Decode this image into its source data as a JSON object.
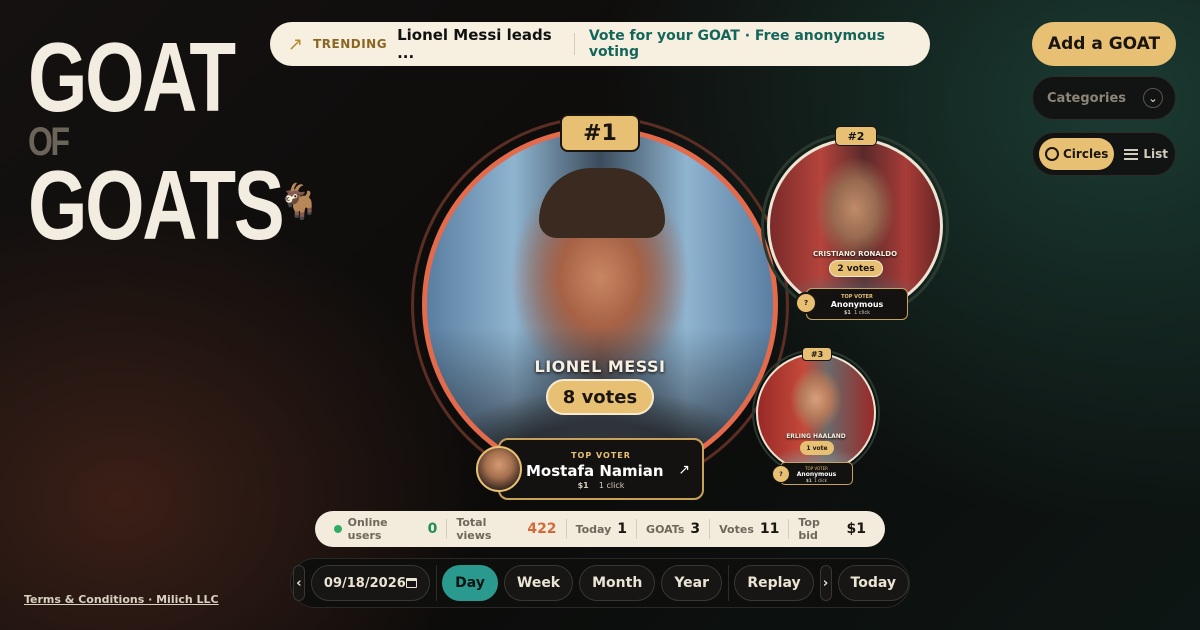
{
  "logo": {
    "line1": "GOAT",
    "line2": "OF",
    "line3": "GOATS",
    "emoji": "🐐"
  },
  "trending": {
    "icon": "trending-up-icon",
    "label": "TRENDING",
    "text": "Lionel Messi leads ...",
    "subtext": "Vote for your GOAT · Free anonymous voting"
  },
  "header": {
    "add_label": "Add a GOAT",
    "categories_label": "Categories",
    "view_circles": "Circles",
    "view_list": "List",
    "active_view": "Circles"
  },
  "ranking": [
    {
      "rank": "#1",
      "name": "LIONEL MESSI",
      "votes": "8 votes",
      "top_voter_label": "TOP VOTER",
      "voter": "Mostafa Namian",
      "bid": "$1",
      "clicks": "1 click"
    },
    {
      "rank": "#2",
      "name": "CRISTIANO RONALDO",
      "votes": "2 votes",
      "top_voter_label": "TOP VOTER",
      "voter": "Anonymous",
      "bid": "$1",
      "clicks": "1 click",
      "avatar": "?"
    },
    {
      "rank": "#3",
      "name": "ERLING HAALAND",
      "votes": "1 vote",
      "top_voter_label": "TOP VOTER",
      "voter": "Anonymous",
      "bid": "$1",
      "clicks": "1 click",
      "avatar": "?"
    }
  ],
  "stats": [
    {
      "label": "Online users",
      "value": "0"
    },
    {
      "label": "Total views",
      "value": "422"
    },
    {
      "label": "Today",
      "value": "1"
    },
    {
      "label": "GOATs",
      "value": "3"
    },
    {
      "label": "Votes",
      "value": "11"
    },
    {
      "label": "Top bid",
      "value": "$1"
    }
  ],
  "nav": {
    "prev": "‹",
    "date": "09/18/2026",
    "periods": [
      "Day",
      "Week",
      "Month",
      "Year"
    ],
    "active_period": "Day",
    "replay": "Replay",
    "next": "›",
    "today": "Today"
  },
  "footer": {
    "terms": "Terms & Conditions · Milich LLC"
  },
  "colors": {
    "accent": "#e7c074",
    "teal": "#2a9a8e",
    "ring": "#e46a4c",
    "online": "#2fae62"
  }
}
